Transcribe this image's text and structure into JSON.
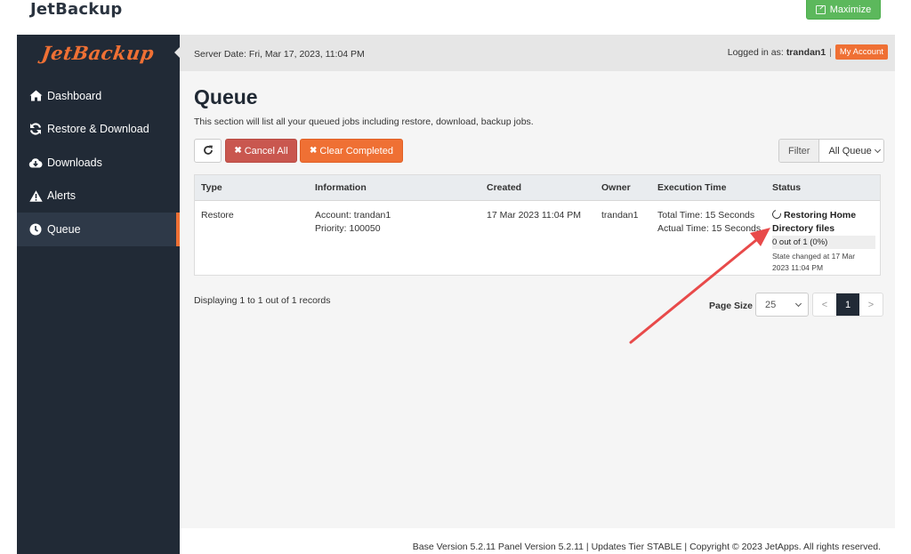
{
  "window": {
    "app_title": "JetBackup",
    "maximize_label": "Maximize"
  },
  "brand": {
    "logo_text": "JetBackup",
    "accent_color": "#ef7034",
    "sidebar_color": "#212a36"
  },
  "header": {
    "server_date": "Server Date: Fri, Mar 17, 2023, 11:04 PM",
    "logged_in_label": "Logged in as:",
    "username": "trandan1",
    "separator": "|",
    "my_account_label": "My Account"
  },
  "sidebar": {
    "items": [
      {
        "label": "Dashboard",
        "icon": "home-icon",
        "active": false
      },
      {
        "label": "Restore & Download",
        "icon": "refresh-icon",
        "active": false
      },
      {
        "label": "Downloads",
        "icon": "cloud-download-icon",
        "active": false
      },
      {
        "label": "Alerts",
        "icon": "warning-icon",
        "active": false
      },
      {
        "label": "Queue",
        "icon": "clock-icon",
        "active": true
      }
    ]
  },
  "main": {
    "title": "Queue",
    "description": "This section will list all your queued jobs including restore, download, backup jobs.",
    "toolbar": {
      "refresh_icon": "refresh-icon",
      "cancel_all_label": "Cancel All",
      "clear_completed_label": "Clear Completed",
      "x_glyph": "✖",
      "filter_label": "Filter",
      "filter_value": "All Queue"
    },
    "table": {
      "columns": [
        "Type",
        "Information",
        "Created",
        "Owner",
        "Execution Time",
        "Status"
      ],
      "rows": [
        {
          "type": "Restore",
          "info_account": "Account: trandan1",
          "info_priority": "Priority: 100050",
          "created": "17 Mar 2023 11:04 PM",
          "owner": "trandan1",
          "total_time": "Total Time: 15 Seconds",
          "actual_time": "Actual Time: 15 Seconds",
          "status_title": "Restoring Home Directory files",
          "progress_text": "0 out of 1 (0%)",
          "progress_percent": 0,
          "state_changed": "State changed at 17 Mar 2023 11:04 PM"
        }
      ]
    },
    "records_text": "Displaying 1 to 1 out of 1 records",
    "pagination": {
      "page_size_label": "Page Size",
      "page_size_value": "25",
      "prev": "<",
      "current_page": "1",
      "next": ">"
    }
  },
  "footer": {
    "text": "Base Version 5.2.11 Panel Version 5.2.11 | Updates Tier STABLE | Copyright © 2023 JetApps. All rights reserved."
  },
  "annotation": {
    "arrow_color": "#e84a4a",
    "points_to": "status-title"
  }
}
